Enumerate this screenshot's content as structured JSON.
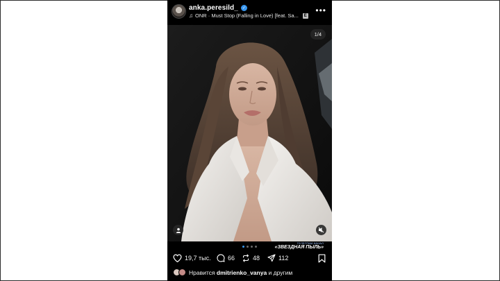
{
  "post": {
    "username": "anka.peresild_",
    "verified": true,
    "music_text": "ONR · Must Stop (Falling in Love) [feat. Sa...",
    "explicit_badge": "E",
    "more_glyph": "•••",
    "image_counter": "1/4",
    "carousel": {
      "total": 4,
      "active_index": 0
    },
    "watermark": {
      "line1": "ТЕЛЕГРАМ-КАНАЛ",
      "line2": "«ЗВЕЗДНАЯ ПЫЛЬ»"
    }
  },
  "actions": {
    "likes_count": "19,7 тыс.",
    "comments_count": "66",
    "reposts_count": "48",
    "shares_count": "112"
  },
  "liked_by": {
    "prefix": "Нравится",
    "user": "dmitrienko_vanya",
    "suffix": "и другим"
  },
  "colors": {
    "accent": "#3897f0",
    "background": "#000000"
  }
}
